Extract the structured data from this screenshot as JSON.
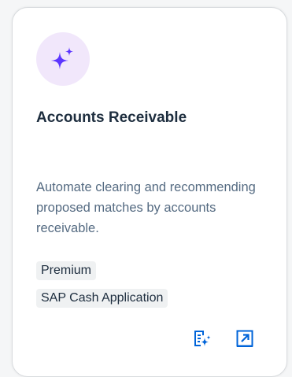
{
  "card": {
    "icon": "ai-sparkle-icon",
    "title": "Accounts Receivable",
    "description": "Automate clearing and recommending proposed matches by accounts receivable.",
    "tags": [
      "Premium",
      "SAP Cash Application"
    ],
    "actions": [
      {
        "icon": "ai-table-icon"
      },
      {
        "icon": "open-external-icon"
      }
    ]
  },
  "colors": {
    "accent": "#0064d9",
    "sparkle": "#5d36ff",
    "icon_background": "#f1e7fb",
    "title": "#1d2d3e",
    "description": "#556b82",
    "tag_background": "#eff1f2"
  }
}
